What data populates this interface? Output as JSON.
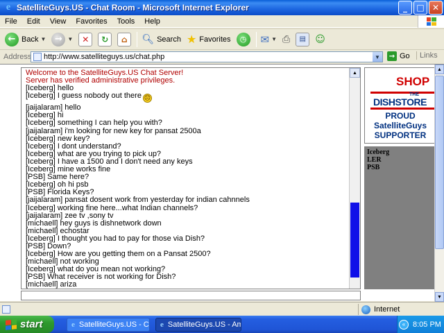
{
  "window": {
    "title": "SatelliteGuys.US - Chat Room - Microsoft Internet Explorer"
  },
  "menu": [
    "File",
    "Edit",
    "View",
    "Favorites",
    "Tools",
    "Help"
  ],
  "toolbar": {
    "back_label": "Back",
    "search_label": "Search",
    "favorites_label": "Favorites"
  },
  "address": {
    "label": "Address",
    "url": "http://www.satelliteguys.us/chat.php",
    "go_label": "Go",
    "links_label": "Links"
  },
  "chat": {
    "messages": [
      {
        "type": "system",
        "text": "Welcome to the SatelliteGuys.US Chat Server!"
      },
      {
        "type": "system",
        "text": "Server has verified administrative privileges."
      },
      {
        "type": "user",
        "text": "[Iceberg] hello"
      },
      {
        "type": "user",
        "text": "[Iceberg] I guess nobody out there",
        "smiley": true
      },
      {
        "type": "user",
        "text": "[jaijalaram] hello"
      },
      {
        "type": "user",
        "text": "[Iceberg] hi"
      },
      {
        "type": "user",
        "text": "[Iceberg] something I can help you with?"
      },
      {
        "type": "user",
        "text": "[jaijalaram] i'm looking for new key for pansat 2500a"
      },
      {
        "type": "user",
        "text": "[Iceberg] new key?"
      },
      {
        "type": "user",
        "text": "[Iceberg] I dont understand?"
      },
      {
        "type": "user",
        "text": "[Iceberg] what are you trying to pick up?"
      },
      {
        "type": "user",
        "text": "[Iceberg] I have a 1500 and I don't need any keys"
      },
      {
        "type": "user",
        "text": "[Iceberg] mine works fine"
      },
      {
        "type": "user",
        "text": "[PSB] Same here?"
      },
      {
        "type": "user",
        "text": "[Iceberg] oh hi psb"
      },
      {
        "type": "user",
        "text": "[PSB] Florida Keys?"
      },
      {
        "type": "user",
        "text": "[jaijalaram] pansat dosent work from yesterday for indian cahnnels"
      },
      {
        "type": "user",
        "text": "[Iceberg] working fine here...what Indian channels?"
      },
      {
        "type": "user",
        "text": "[jaijalaram] zee tv ,sony tv"
      },
      {
        "type": "user",
        "text": "[michaell] hey guys is dishnetwork down"
      },
      {
        "type": "user",
        "text": "[michaell] echostar"
      },
      {
        "type": "user",
        "text": "[Iceberg] I thought you had to pay for those via Dish?"
      },
      {
        "type": "user",
        "text": "[PSB] Down?"
      },
      {
        "type": "user",
        "text": "[Iceberg] How are you getting them on a Pansat 2500?"
      },
      {
        "type": "user",
        "text": "[michaell] not working"
      },
      {
        "type": "user",
        "text": "[Iceberg] what do you mean not working?"
      },
      {
        "type": "user",
        "text": "[PSB] What receiver is not working for Dish?"
      },
      {
        "type": "user",
        "text": "[michaell] ariza"
      }
    ],
    "scrollbar_position": 0.62
  },
  "ad": {
    "shop": "SHOP",
    "the": "THE",
    "dish": "DISHSTORE",
    "proud": "PROUD",
    "brand": "SatelliteGuys",
    "supporter": "SUPPORTER"
  },
  "users": [
    "Iceberg",
    "LER",
    "PSB"
  ],
  "status": {
    "zone": "Internet"
  },
  "taskbar": {
    "start_label": "start",
    "tasks": [
      "SatelliteGuys.US - Ch...",
      "SatelliteGuys.US - Am..."
    ],
    "clock": "8:05 PM"
  },
  "colors": {
    "system_message": "#b00000",
    "chat_scroll_thumb": "#1010e8",
    "taskbar": "#245ee0",
    "start_button": "#2e9a2e"
  }
}
